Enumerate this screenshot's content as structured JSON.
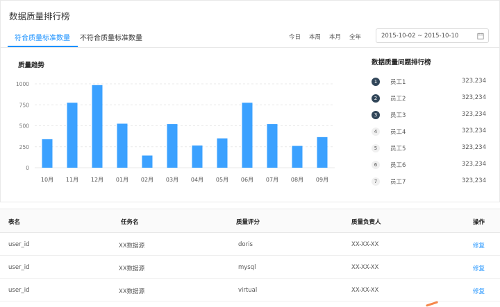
{
  "header": {
    "title": "数据质量排行榜"
  },
  "tabs": [
    {
      "label": "符合质量标准数量",
      "active": true
    },
    {
      "label": "不符合质量标准数量",
      "active": false
    }
  ],
  "range_buttons": [
    "今日",
    "本周",
    "本月",
    "全年"
  ],
  "date_range": {
    "value": "2015-10-02 ~ 2015-10-10",
    "icon": "calendar-icon"
  },
  "trend": {
    "title": "质量趋势"
  },
  "chart_data": {
    "type": "bar",
    "title": "质量趋势",
    "categories": [
      "10月",
      "11月",
      "12月",
      "01月",
      "02月",
      "03月",
      "04月",
      "05月",
      "06月",
      "07月",
      "08月",
      "09月"
    ],
    "values": [
      340,
      775,
      985,
      525,
      145,
      520,
      265,
      350,
      775,
      520,
      260,
      365
    ],
    "ylim": [
      0,
      1000
    ],
    "yticks": [
      0,
      250,
      500,
      750,
      1000
    ],
    "grid": true,
    "color": "#3ba1ff",
    "xlabel": "",
    "ylabel": ""
  },
  "ranking": {
    "title": "数据质量问题排行榜",
    "items": [
      {
        "rank": "1",
        "name": "员工1",
        "value": "323,234",
        "top": true
      },
      {
        "rank": "2",
        "name": "员工2",
        "value": "323,234",
        "top": true
      },
      {
        "rank": "3",
        "name": "员工3",
        "value": "323,234",
        "top": true
      },
      {
        "rank": "4",
        "name": "员工4",
        "value": "323,234",
        "top": false
      },
      {
        "rank": "5",
        "name": "员工5",
        "value": "323,234",
        "top": false
      },
      {
        "rank": "6",
        "name": "员工6",
        "value": "323,234",
        "top": false
      },
      {
        "rank": "7",
        "name": "员工7",
        "value": "323,234",
        "top": false
      }
    ]
  },
  "table": {
    "columns": [
      "表名",
      "任务名",
      "质量评分",
      "质量负责人",
      "操作"
    ],
    "rows": [
      {
        "table": "user_id",
        "task": "XX数据源",
        "score": "doris",
        "owner": "XX-XX-XX",
        "action": "修复"
      },
      {
        "table": "user_id",
        "task": "XX数据源",
        "score": "mysql",
        "owner": "XX-XX-XX",
        "action": "修复"
      },
      {
        "table": "user_id",
        "task": "XX数据源",
        "score": "virtual",
        "owner": "XX-XX-XX",
        "action": "修复"
      }
    ]
  },
  "colors": {
    "accent": "#1890ff",
    "bar": "#3ba1ff",
    "badge_dark": "#314659"
  }
}
